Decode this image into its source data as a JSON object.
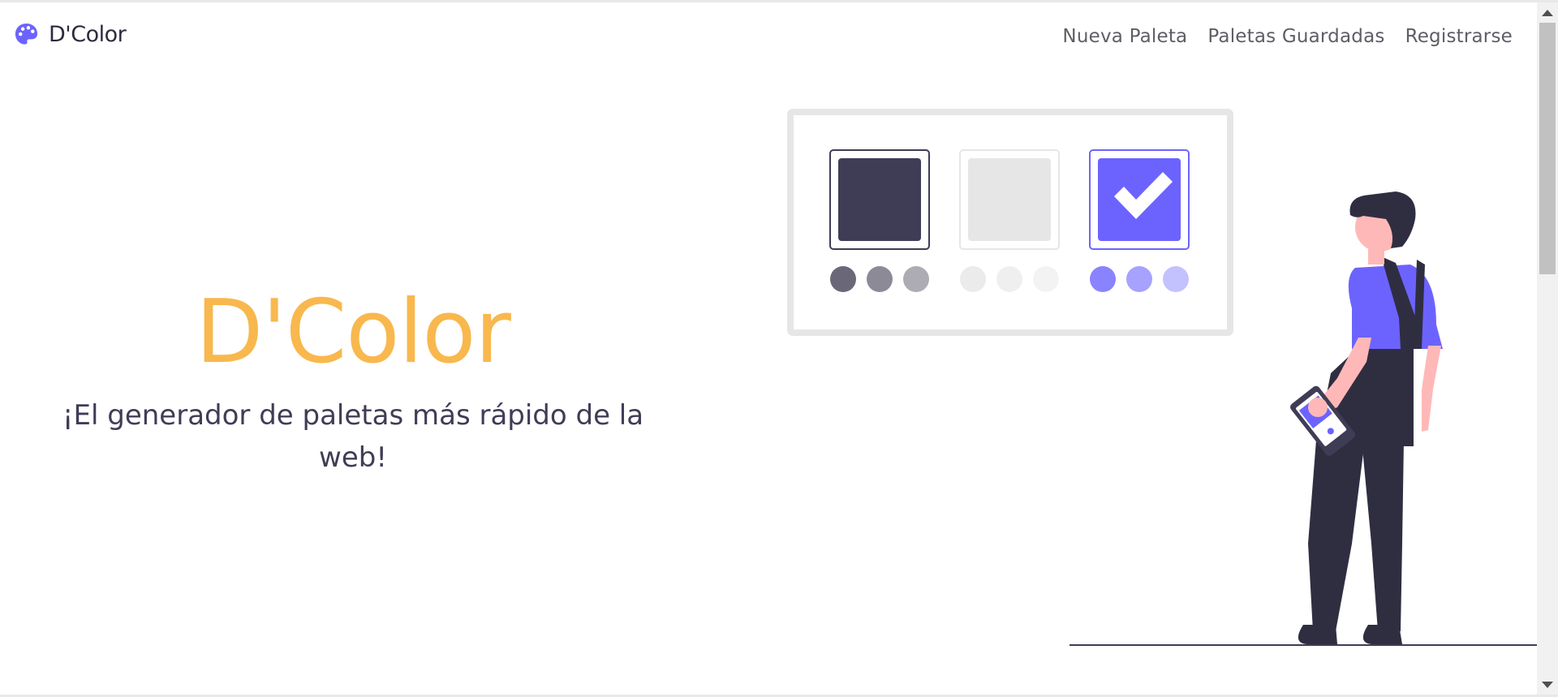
{
  "navbar": {
    "brand": {
      "name": "D'Color",
      "icon": "palette-icon"
    },
    "links": [
      {
        "label": "Nueva Paleta"
      },
      {
        "label": "Paletas Guardadas"
      },
      {
        "label": "Registrarse"
      }
    ]
  },
  "hero": {
    "title": "D'Color",
    "subtitle": "¡El generador de paletas más rápido de la web!"
  },
  "illustration": {
    "icon": "person-choosing-palette-illustration",
    "swatches": [
      {
        "main_color": "#3f3d56",
        "selected": false,
        "dots": [
          "#6a6878",
          "#8b8a96",
          "#adacb5"
        ]
      },
      {
        "main_color": "#e6e6e6",
        "selected": false,
        "dots": [
          "#ebebeb",
          "#efefef",
          "#f3f3f3"
        ]
      },
      {
        "main_color": "#6c63ff",
        "selected": true,
        "dots": [
          "#8a83ff",
          "#a7a1ff",
          "#c4c1ff"
        ]
      }
    ]
  },
  "colors": {
    "accent": "#6c63ff",
    "title": "#f8b84e",
    "dark": "#3f3d56",
    "skin": "#ffb8b8"
  }
}
